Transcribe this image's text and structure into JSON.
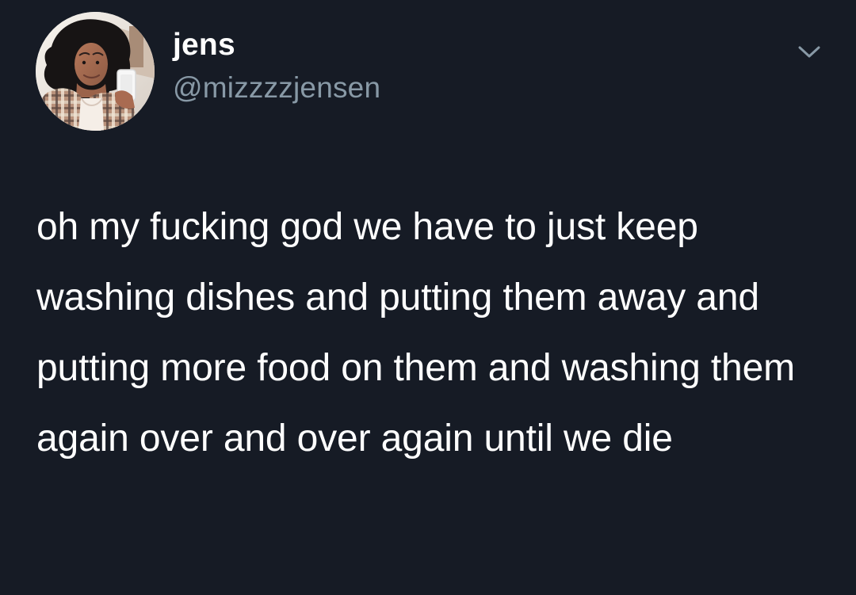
{
  "author": {
    "display_name": "jens",
    "handle": "@mizzzzjensen",
    "avatar_icon": "profile-photo"
  },
  "header": {
    "menu_icon": "chevron-down-icon"
  },
  "tweet": {
    "text": "oh my fucking god we have to just keep washing dishes and putting them away and putting more food on them and washing them again over and over again until we die"
  },
  "colors": {
    "background": "#161b25",
    "primary_text": "#ffffff",
    "secondary_text": "#8899a6",
    "chevron": "#8899a6"
  }
}
